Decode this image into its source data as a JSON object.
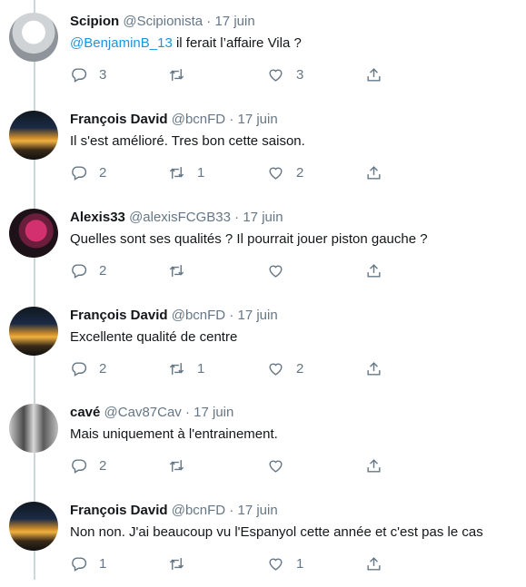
{
  "tweets": [
    {
      "avatar": "statue-avatar",
      "name": "Scipion",
      "handle": "@Scipionista",
      "date": "17 juin",
      "mention": "@BenjaminB_13",
      "text": " il ferait l’affaire Vila ?",
      "replies": "3",
      "retweets": "",
      "likes": "3"
    },
    {
      "avatar": "stadium-avatar",
      "name": "François David",
      "handle": "@bcnFD",
      "date": "17 juin",
      "mention": "",
      "text": "Il s'est amélioré. Tres bon cette saison.",
      "replies": "2",
      "retweets": "1",
      "likes": "2"
    },
    {
      "avatar": "person-avatar",
      "name": "Alexis33",
      "handle": "@alexisFCGB33",
      "date": "17 juin",
      "mention": "",
      "text": "Quelles sont ses qualités ? Il pourrait jouer piston gauche ?",
      "replies": "2",
      "retweets": "",
      "likes": ""
    },
    {
      "avatar": "stadium-avatar",
      "name": "François David",
      "handle": "@bcnFD",
      "date": "17 juin",
      "mention": "",
      "text": "Excellente qualité de centre",
      "replies": "2",
      "retweets": "1",
      "likes": "2"
    },
    {
      "avatar": "players-avatar",
      "name": "cavé",
      "handle": "@Cav87Cav",
      "date": "17 juin",
      "mention": "",
      "text": "Mais uniquement à l'entrainement.",
      "replies": "2",
      "retweets": "",
      "likes": ""
    },
    {
      "avatar": "stadium-avatar",
      "name": "François David",
      "handle": "@bcnFD",
      "date": "17 juin",
      "mention": "",
      "text": "Non non. J'ai beaucoup vu l'Espanyol cette année et c'est pas le cas",
      "replies": "1",
      "retweets": "",
      "likes": "1"
    }
  ],
  "separator": "·",
  "colors": {
    "text": "#14171a",
    "secondary": "#657786",
    "link": "#1b95e0",
    "thread": "#ccd6dd"
  },
  "icons": [
    "reply-icon",
    "retweet-icon",
    "like-icon",
    "share-icon"
  ]
}
